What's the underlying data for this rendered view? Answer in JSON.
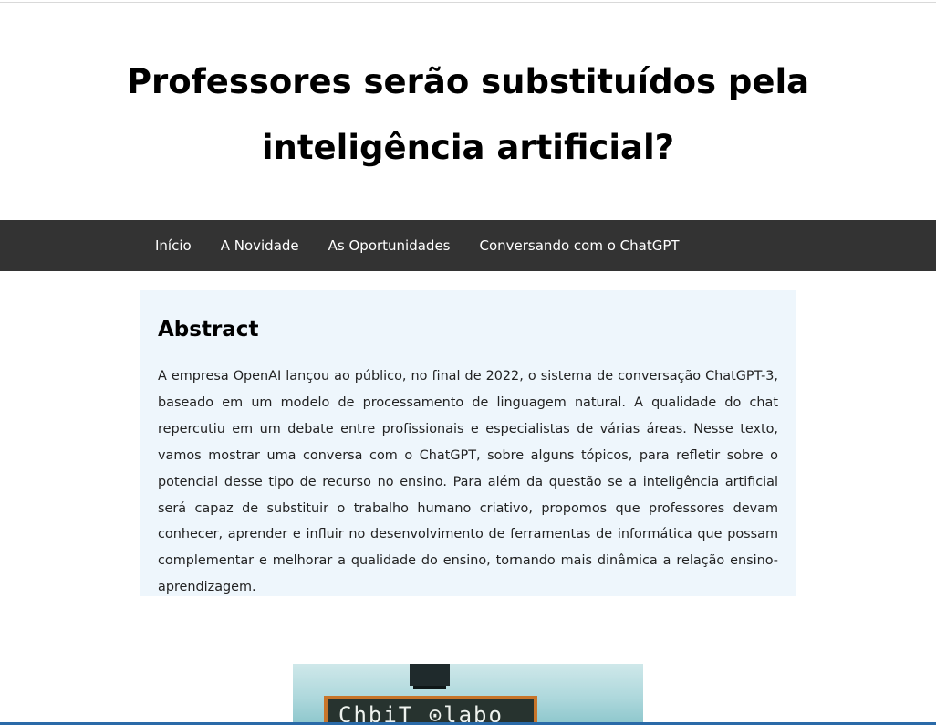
{
  "page": {
    "title": "Professores serão substituídos pela inteligência artificial?"
  },
  "nav": {
    "items": [
      {
        "label": "Início"
      },
      {
        "label": "A Novidade"
      },
      {
        "label": "As Oportunidades"
      },
      {
        "label": "Conversando com o ChatGPT"
      }
    ]
  },
  "abstract": {
    "heading": "Abstract",
    "text": "A empresa OpenAI lançou ao público, no final de 2022, o sistema de conversação ChatGPT-3, baseado em um modelo de processamento de linguagem natural. A qualidade do chat repercutiu em um debate entre profissionais e especialistas de várias áreas. Nesse texto, vamos mostrar uma conversa com o ChatGPT, sobre alguns tópicos, para refletir sobre o potencial desse tipo de recurso no ensino. Para além da questão se a inteligência artificial será capaz de substituir o trabalho humano criativo, propomos que professores devam conhecer, aprender e influir no desenvolvimento de ferramentas de informática que possam complementar e melhorar a qualidade do ensino, tornando mais dinâmica a relação ensino-aprendizagem."
  },
  "hero_image": {
    "chalkboard_text": "ChbiT ⊙labo"
  },
  "colors": {
    "nav_background": "#333333",
    "abstract_background": "#eef6fc",
    "accent_line": "#2a6aa8"
  }
}
